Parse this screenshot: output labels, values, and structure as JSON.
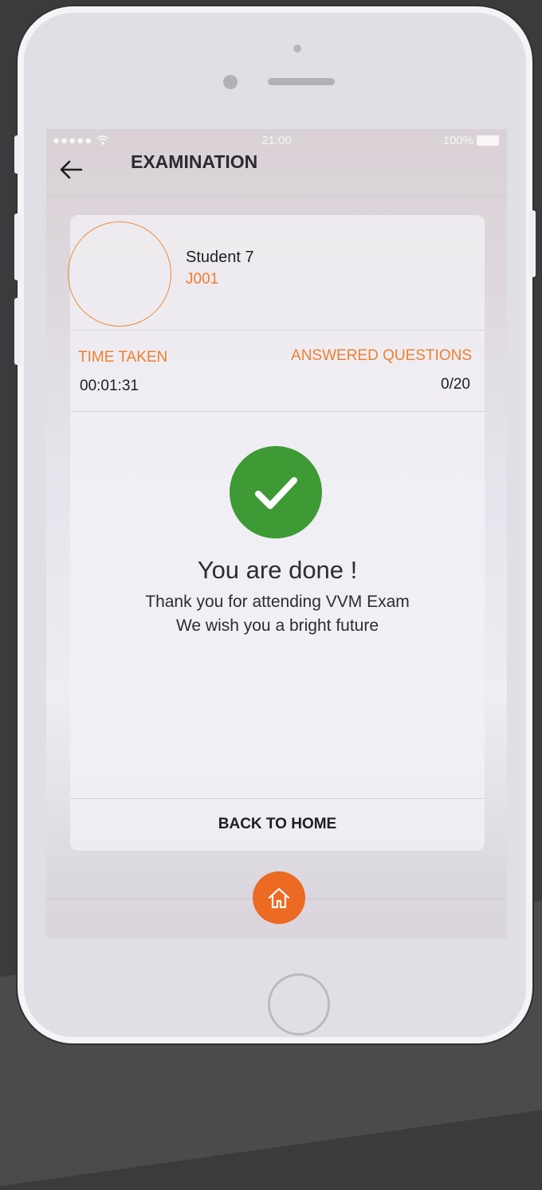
{
  "status_bar": {
    "signal": "●●●●●",
    "time": "21:00",
    "battery": "100%"
  },
  "app_bar": {
    "title": "EXAMINATION"
  },
  "student": {
    "name": "Student 7",
    "id": "J001"
  },
  "stats": {
    "time_taken_label": "TIME TAKEN",
    "time_taken_value": "00:01:31",
    "answered_label": "ANSWERED QUESTIONS",
    "answered_value": "0/20"
  },
  "result": {
    "title": "You are done !",
    "line1": "Thank you for attending VVM Exam",
    "line2": "We wish you a bright future"
  },
  "actions": {
    "back_to_home": "BACK TO HOME"
  },
  "colors": {
    "accent": "#ef7f2f",
    "success": "#3e9a34",
    "fab": "#ec6a22"
  }
}
